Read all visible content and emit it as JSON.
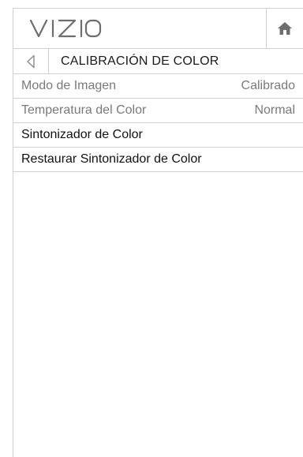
{
  "brand": {
    "logo_text": "VIZIO"
  },
  "nav": {
    "title": "CALIBRACIÓN DE COLOR"
  },
  "menu": {
    "items": [
      {
        "label": "Modo de Imagen",
        "value": "Calibrado"
      },
      {
        "label": "Temperatura del Color",
        "value": "Normal"
      },
      {
        "label": "Sintonizador de Color",
        "value": ""
      },
      {
        "label": "Restaurar Sintonizador de Color",
        "value": ""
      }
    ]
  },
  "icons": {
    "home": "home-icon",
    "back": "back-triangle-icon"
  },
  "colors": {
    "border": "#cfcfcf",
    "text": "#111111",
    "muted": "#7a7a7a"
  }
}
